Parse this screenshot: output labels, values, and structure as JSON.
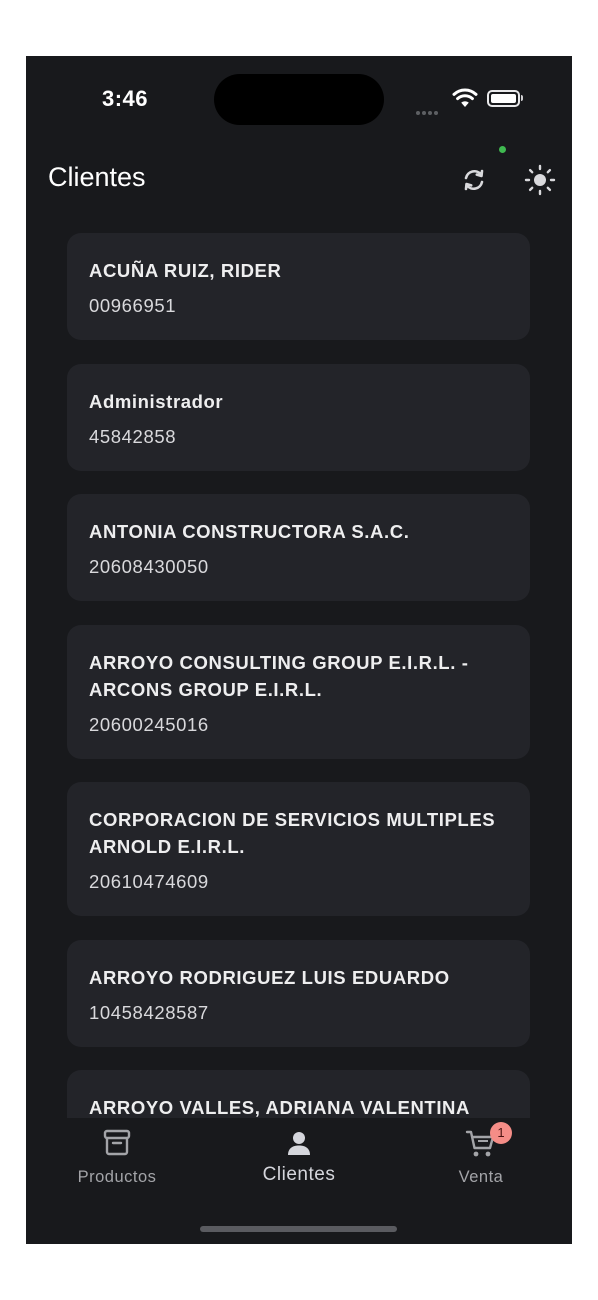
{
  "status_bar": {
    "time": "3:46"
  },
  "header": {
    "title": "Clientes",
    "sync_icon": "sync-icon",
    "theme_icon": "sun-icon",
    "sync_status_color": "#3fb950"
  },
  "clients": [
    {
      "name": "ACUÑA RUIZ, RIDER",
      "doc": "00966951"
    },
    {
      "name": "Administrador",
      "doc": "45842858"
    },
    {
      "name": "ANTONIA CONSTRUCTORA S.A.C.",
      "doc": "20608430050"
    },
    {
      "name": "ARROYO CONSULTING GROUP E.I.R.L. - ARCONS GROUP E.I.R.L.",
      "doc": "20600245016"
    },
    {
      "name": "CORPORACION DE SERVICIOS MULTIPLES ARNOLD E.I.R.L.",
      "doc": "20610474609"
    },
    {
      "name": "ARROYO RODRIGUEZ LUIS EDUARDO",
      "doc": "10458428587"
    },
    {
      "name": "ARROYO VALLES, ADRIANA VALENTINA",
      "doc": ""
    }
  ],
  "tabbar": {
    "tabs": [
      {
        "label": "Productos",
        "icon": "archive-box-icon"
      },
      {
        "label": "Clientes",
        "icon": "person-icon"
      },
      {
        "label": "Venta",
        "icon": "cart-icon"
      }
    ],
    "active_tab": "Clientes",
    "cart_badge": "1"
  },
  "colors": {
    "background": "#18191c",
    "card": "#232429",
    "badge": "#f58d87"
  }
}
